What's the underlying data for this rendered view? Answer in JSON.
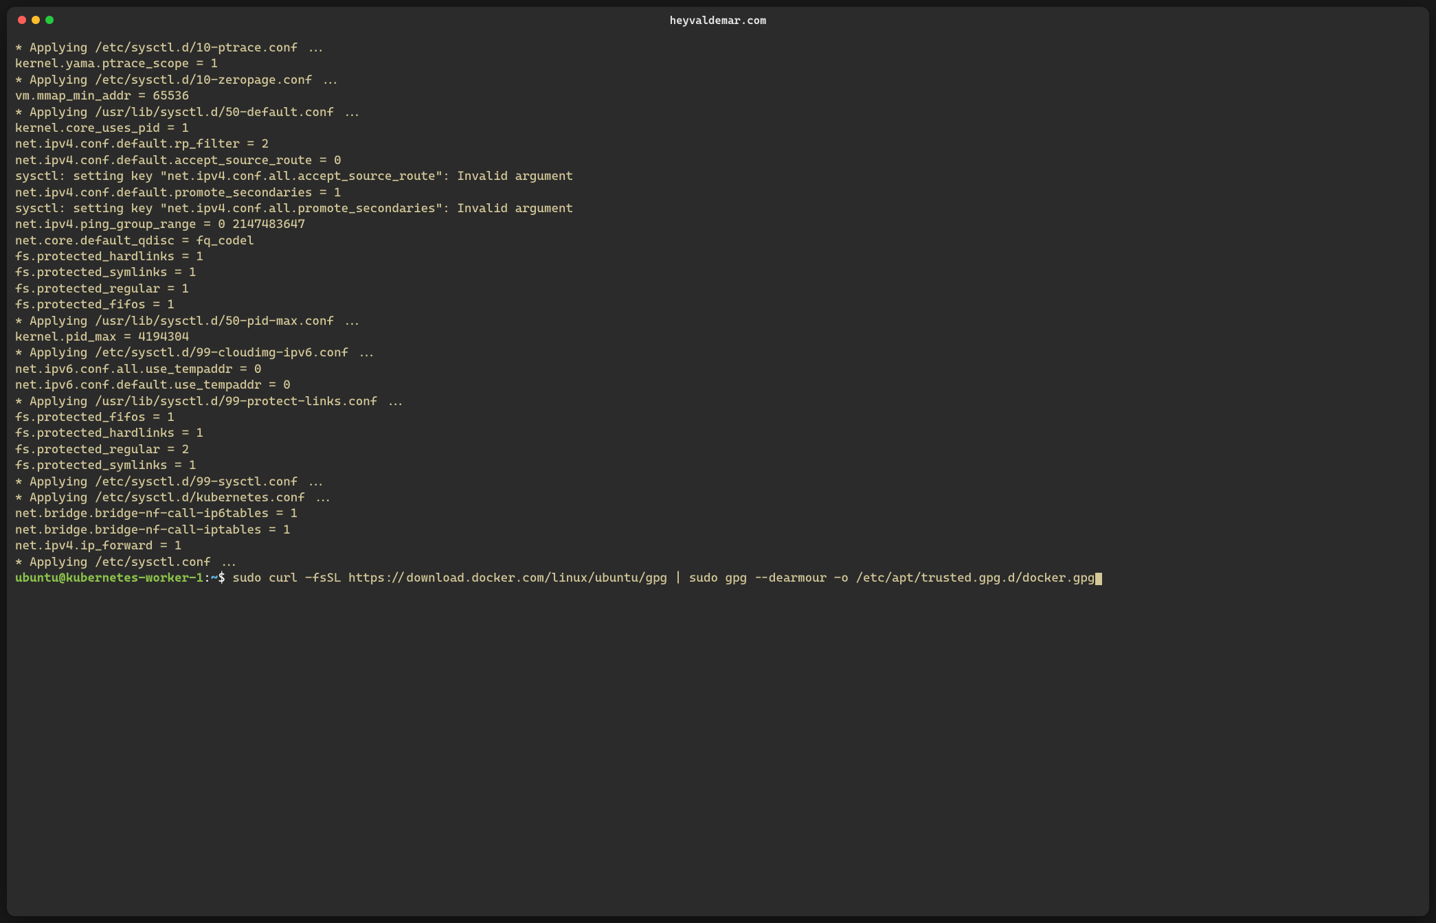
{
  "window": {
    "title": "heyvaldemar.com"
  },
  "output": [
    "* Applying /etc/sysctl.d/10-ptrace.conf ...",
    "kernel.yama.ptrace_scope = 1",
    "* Applying /etc/sysctl.d/10-zeropage.conf ...",
    "vm.mmap_min_addr = 65536",
    "* Applying /usr/lib/sysctl.d/50-default.conf ...",
    "kernel.core_uses_pid = 1",
    "net.ipv4.conf.default.rp_filter = 2",
    "net.ipv4.conf.default.accept_source_route = 0",
    "sysctl: setting key \"net.ipv4.conf.all.accept_source_route\": Invalid argument",
    "net.ipv4.conf.default.promote_secondaries = 1",
    "sysctl: setting key \"net.ipv4.conf.all.promote_secondaries\": Invalid argument",
    "net.ipv4.ping_group_range = 0 2147483647",
    "net.core.default_qdisc = fq_codel",
    "fs.protected_hardlinks = 1",
    "fs.protected_symlinks = 1",
    "fs.protected_regular = 1",
    "fs.protected_fifos = 1",
    "* Applying /usr/lib/sysctl.d/50-pid-max.conf ...",
    "kernel.pid_max = 4194304",
    "* Applying /etc/sysctl.d/99-cloudimg-ipv6.conf ...",
    "net.ipv6.conf.all.use_tempaddr = 0",
    "net.ipv6.conf.default.use_tempaddr = 0",
    "* Applying /usr/lib/sysctl.d/99-protect-links.conf ...",
    "fs.protected_fifos = 1",
    "fs.protected_hardlinks = 1",
    "fs.protected_regular = 2",
    "fs.protected_symlinks = 1",
    "* Applying /etc/sysctl.d/99-sysctl.conf ...",
    "* Applying /etc/sysctl.d/kubernetes.conf ...",
    "net.bridge.bridge-nf-call-ip6tables = 1",
    "net.bridge.bridge-nf-call-iptables = 1",
    "net.ipv4.ip_forward = 1",
    "* Applying /etc/sysctl.conf ..."
  ],
  "prompt": {
    "user": "ubuntu@kubernetes-worker-1",
    "separator": ":",
    "path": "~",
    "dollar": "$",
    "command": "sudo curl -fsSL https://download.docker.com/linux/ubuntu/gpg | sudo gpg --dearmour -o /etc/apt/trusted.gpg.d/docker.gpg"
  }
}
